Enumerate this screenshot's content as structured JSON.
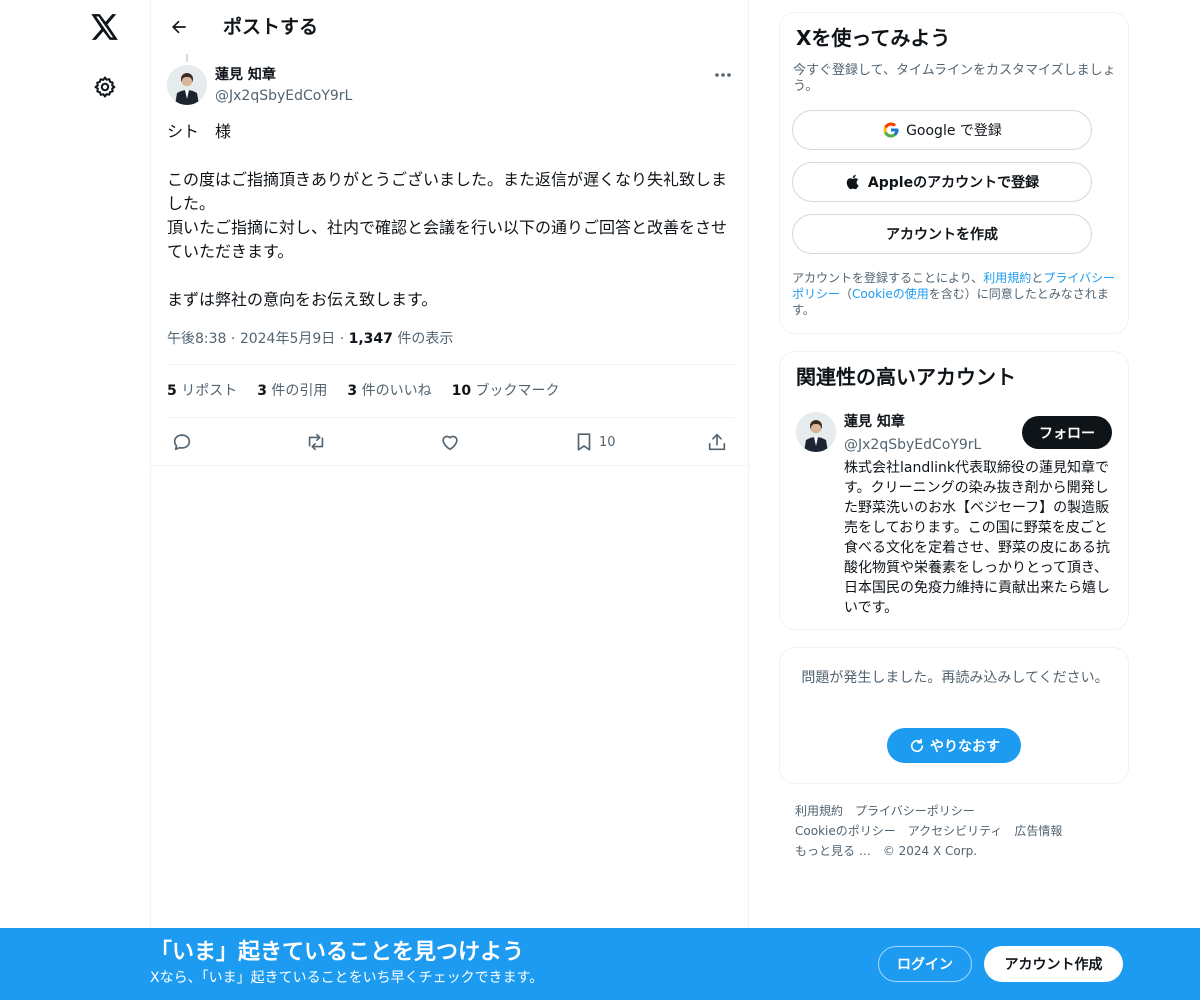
{
  "header": {
    "title": "ポストする"
  },
  "post": {
    "author_name": "蓮見 知章",
    "author_handle": "@Jx2qSbyEdCoY9rL",
    "text_lines": [
      "シト　様",
      "",
      "この度はご指摘頂きありがとうございました。また返信が遅くなり失礼致しました。",
      "頂いたご指摘に対し、社内で確認と会議を行い以下の通りご回答と改善をさせていただきます。",
      "",
      "まずは弊社の意向をお伝え致します。"
    ],
    "time": "午後8:38",
    "date": "2024年5月9日",
    "views_count": "1,347",
    "views_label": "件の表示",
    "stats": {
      "reposts_count": "5",
      "reposts_label": "リポスト",
      "quotes_count": "3",
      "quotes_label": "件の引用",
      "likes_count": "3",
      "likes_label": "件のいいね",
      "bookmarks_count": "10",
      "bookmarks_label": "ブックマーク"
    },
    "bookmark_action_count": "10"
  },
  "signup": {
    "title": "Xを使ってみよう",
    "subtitle": "今すぐ登録して、タイムラインをカスタマイズしましょう。",
    "google_label": "Google で登録",
    "apple_label": "Appleのアカウントで登録",
    "create_label": "アカウントを作成",
    "terms_prefix": "アカウントを登録することにより、",
    "terms_link1": "利用規約",
    "terms_and": "と",
    "terms_link2": "プライバシーポリシー",
    "terms_paren_open": "（",
    "terms_link3": "Cookieの使用",
    "terms_suffix": "を含む）に同意したとみなされます。"
  },
  "related": {
    "title": "関連性の高いアカウント",
    "name": "蓮見 知章",
    "handle": "@Jx2qSbyEdCoY9rL",
    "follow_label": "フォロー",
    "bio": "株式会社landlink代表取締役の蓮見知章です。クリーニングの染み抜き剤から開発した野菜洗いのお水【ベジセーフ】の製造販売をしております。この国に野菜を皮ごと食べる文化を定着させ、野菜の皮にある抗酸化物質や栄養素をしっかりとって頂き、日本国民の免疫力維持に貢献出来たら嬉しいです。"
  },
  "error": {
    "message": "問題が発生しました。再読み込みしてください。",
    "retry_label": "やりなおす"
  },
  "footer": {
    "row1": [
      "利用規約",
      "プライバシーポリシー"
    ],
    "row2": [
      "Cookieのポリシー",
      "アクセシビリティ",
      "広告情報"
    ],
    "more": "もっと見る …",
    "copyright": "© 2024 X Corp."
  },
  "banner": {
    "title": "「いま」起きていることを見つけよう",
    "subtitle": "Xなら、「いま」起きていることをいち早くチェックできます。",
    "login_label": "ログイン",
    "create_label": "アカウント作成"
  },
  "colors": {
    "accent": "#1d9bf0",
    "text": "#0f1419",
    "muted": "#536471",
    "border": "#eff3f4"
  },
  "icons": [
    "x-logo-icon",
    "gear-icon",
    "back-arrow-icon",
    "more-icon",
    "reply-icon",
    "repost-icon",
    "like-icon",
    "bookmark-icon",
    "share-icon",
    "google-icon",
    "apple-icon",
    "refresh-icon"
  ]
}
